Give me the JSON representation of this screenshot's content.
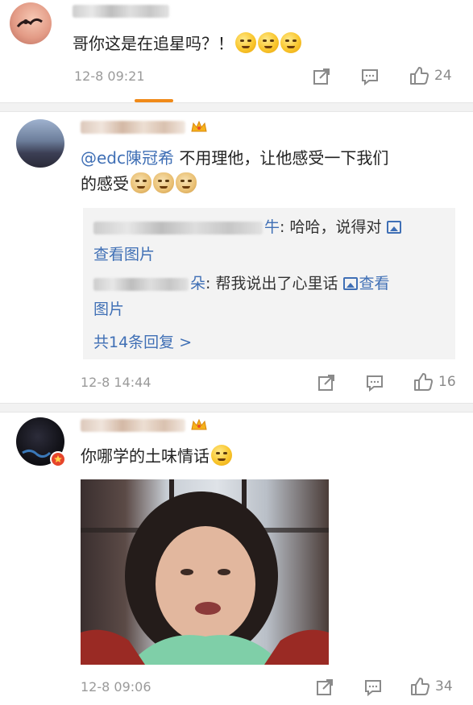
{
  "comments": [
    {
      "text": "哥你这是在追星吗？！",
      "emoji": [
        "grin-icon",
        "grin-icon",
        "grin-icon"
      ],
      "time": "12-8 09:21",
      "likes": "24"
    },
    {
      "mention": "@edc陳冠希",
      "text_a": " 不用理他，让他感受一下我们",
      "text_b": "的感受",
      "emoji": [
        "doge-icon",
        "doge-icon",
        "doge-icon"
      ],
      "replies": [
        {
          "name_tail": "牛",
          "text": ": 哈哈，说得对",
          "link": "查看图片"
        },
        {
          "name_tail": "朵",
          "text": ": 帮我说出了心里话",
          "link_a": "查看",
          "link_b": "图片"
        }
      ],
      "more_replies": "共14条回复 >",
      "time": "12-8 14:44",
      "likes": "16"
    },
    {
      "text": "你哪学的土味情话",
      "emoji": [
        "smirk-icon"
      ],
      "time": "12-8 09:06",
      "likes": "34"
    }
  ],
  "colors": {
    "accent": "#f08a18",
    "link": "#3f6fb5",
    "divider": "#f2f2f2",
    "meta": "#9a9a9a"
  }
}
